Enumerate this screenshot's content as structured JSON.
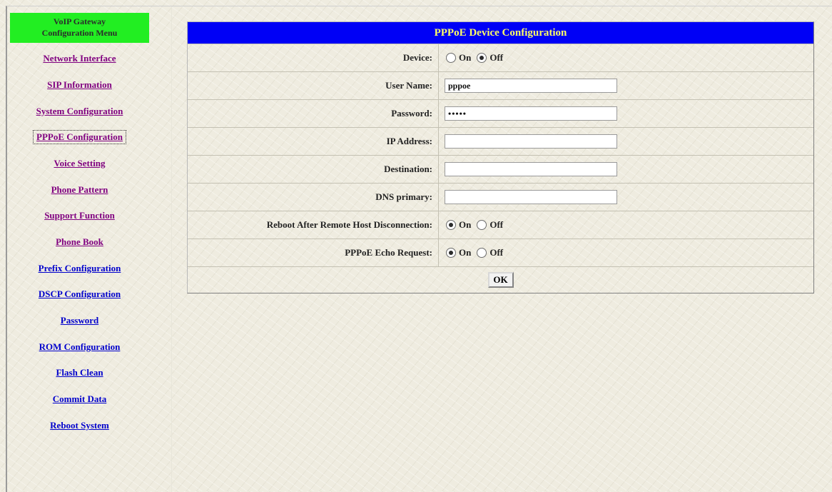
{
  "menu": {
    "header_line1": "VoIP Gateway",
    "header_line2": "Configuration Menu",
    "items": [
      {
        "label": "Network Interface",
        "state": "visited"
      },
      {
        "label": "SIP Information",
        "state": "visited"
      },
      {
        "label": "System Configuration",
        "state": "visited"
      },
      {
        "label": "PPPoE Configuration",
        "state": "active"
      },
      {
        "label": "Voice Setting",
        "state": "visited"
      },
      {
        "label": "Phone Pattern",
        "state": "visited"
      },
      {
        "label": "Support Function",
        "state": "visited"
      },
      {
        "label": "Phone Book",
        "state": "visited"
      },
      {
        "label": "Prefix Configuration",
        "state": "link"
      },
      {
        "label": "DSCP Configuration",
        "state": "link"
      },
      {
        "label": "Password",
        "state": "link"
      },
      {
        "label": "ROM Configuration",
        "state": "link"
      },
      {
        "label": "Flash Clean",
        "state": "link"
      },
      {
        "label": "Commit Data",
        "state": "link"
      },
      {
        "label": "Reboot System",
        "state": "link"
      }
    ]
  },
  "form": {
    "title": "PPPoE Device Configuration",
    "device": {
      "label": "Device:",
      "on": "On",
      "off": "Off",
      "selected": "off"
    },
    "username": {
      "label": "User Name:",
      "value": "pppoe"
    },
    "password": {
      "label": "Password:",
      "value": "•••••"
    },
    "ip_address": {
      "label": "IP Address:",
      "value": ""
    },
    "destination": {
      "label": "Destination:",
      "value": ""
    },
    "dns_primary": {
      "label": "DNS primary:",
      "value": ""
    },
    "reboot": {
      "label": "Reboot After Remote Host Disconnection:",
      "on": "On",
      "off": "Off",
      "selected": "on"
    },
    "echo": {
      "label": "PPPoE Echo Request:",
      "on": "On",
      "off": "Off",
      "selected": "on"
    },
    "ok_label": "OK"
  },
  "colors": {
    "menu_header_bg": "#22ee22",
    "title_bar_bg": "#0000f6",
    "title_text": "#ffff66",
    "visited_link": "#800080",
    "link": "#0000cc"
  }
}
